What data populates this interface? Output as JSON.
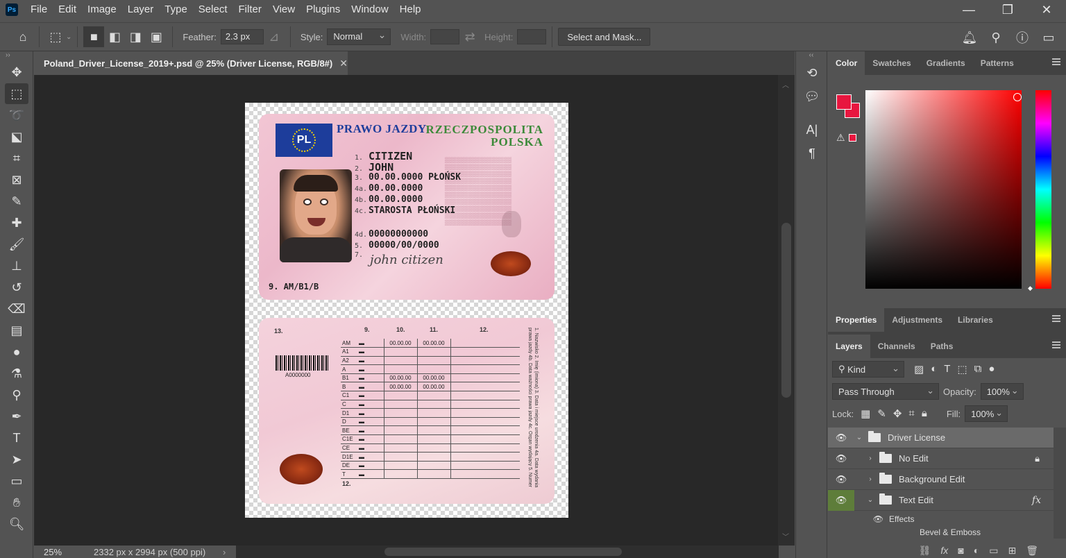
{
  "app": {
    "logo": "Ps"
  },
  "menu": [
    "File",
    "Edit",
    "Image",
    "Layer",
    "Type",
    "Select",
    "Filter",
    "View",
    "Plugins",
    "Window",
    "Help"
  ],
  "options": {
    "feather_label": "Feather:",
    "feather_value": "2.3 px",
    "style_label": "Style:",
    "style_value": "Normal",
    "width_label": "Width:",
    "height_label": "Height:",
    "select_mask": "Select and Mask..."
  },
  "document": {
    "tab_title": "Poland_Driver_License_2019+.psd @ 25% (Driver License, RGB/8#)",
    "zoom": "25%",
    "info": "2332 px x 2994 px (500 ppi)"
  },
  "license_front": {
    "country_code": "PL",
    "title": "PRAWO JAZDY",
    "country_name_1": "RZECZPOSPOLITA",
    "country_name_2": "POLSKA",
    "fields": [
      {
        "num": "1.",
        "value": "CITIZEN"
      },
      {
        "num": "2.",
        "value": "JOHN"
      },
      {
        "num": "3.",
        "value": "00.00.0000 PŁOŃSK"
      },
      {
        "num": "4a.",
        "value": "00.00.0000"
      },
      {
        "num": "4b.",
        "value": "00.00.0000"
      },
      {
        "num": "4c.",
        "value": "STAROSTA PŁOŃSKI"
      },
      {
        "num": "4d.",
        "value": "00000000000"
      },
      {
        "num": "5.",
        "value": "00000/00/0000"
      },
      {
        "num": "7.",
        "value": ""
      }
    ],
    "signature": "john citizen",
    "categories": "9. AM/B1/B"
  },
  "license_back": {
    "barcode_text": "A0000000",
    "col_13": "13.",
    "col_9": "9.",
    "col_10": "10.",
    "col_11": "11.",
    "col_12": "12.",
    "row_12": "12.",
    "rows": [
      {
        "cat": "AM",
        "d10": "00.00.00",
        "d11": "00.00.00"
      },
      {
        "cat": "A1",
        "d10": "",
        "d11": ""
      },
      {
        "cat": "A2",
        "d10": "",
        "d11": ""
      },
      {
        "cat": "A",
        "d10": "",
        "d11": ""
      },
      {
        "cat": "B1",
        "d10": "00.00.00",
        "d11": "00.00.00"
      },
      {
        "cat": "B",
        "d10": "00.00.00",
        "d11": "00.00.00"
      },
      {
        "cat": "C1",
        "d10": "",
        "d11": ""
      },
      {
        "cat": "C",
        "d10": "",
        "d11": ""
      },
      {
        "cat": "D1",
        "d10": "",
        "d11": ""
      },
      {
        "cat": "D",
        "d10": "",
        "d11": ""
      },
      {
        "cat": "BE",
        "d10": "",
        "d11": ""
      },
      {
        "cat": "C1E",
        "d10": "",
        "d11": ""
      },
      {
        "cat": "CE",
        "d10": "",
        "d11": ""
      },
      {
        "cat": "D1E",
        "d10": "",
        "d11": ""
      },
      {
        "cat": "DE",
        "d10": "",
        "d11": ""
      },
      {
        "cat": "T",
        "d10": "",
        "d11": ""
      }
    ],
    "vertical_text": "1. Nazwisko 2. Imię (imiona) 3. Data i miejsce urodzenia 4a. Data wydania prawa jazdy 4b. Data ważności prawa jazdy 4c. Organ wydający 5. Numer prawa jazdy 10. Ważne od 11. Ważne do 12. Ograniczenia"
  },
  "color_panel": {
    "tabs": [
      "Color",
      "Swatches",
      "Gradients",
      "Patterns"
    ],
    "foreground": "#e8163f"
  },
  "properties_tabs": [
    "Properties",
    "Adjustments",
    "Libraries"
  ],
  "layers_panel": {
    "tabs": [
      "Layers",
      "Channels",
      "Paths"
    ],
    "filter_kind": "Kind",
    "blend_mode": "Pass Through",
    "opacity_label": "Opacity:",
    "opacity_value": "100%",
    "lock_label": "Lock:",
    "fill_label": "Fill:",
    "fill_value": "100%",
    "layers": [
      {
        "name": "Driver License",
        "level": 0,
        "expanded": true
      },
      {
        "name": "No Edit",
        "level": 1,
        "expanded": false,
        "locked": true
      },
      {
        "name": "Background Edit",
        "level": 1,
        "expanded": false
      },
      {
        "name": "Text Edit",
        "level": 1,
        "expanded": true,
        "fx": true
      }
    ],
    "effects_label": "Effects",
    "bevel_label": "Bevel & Emboss"
  }
}
